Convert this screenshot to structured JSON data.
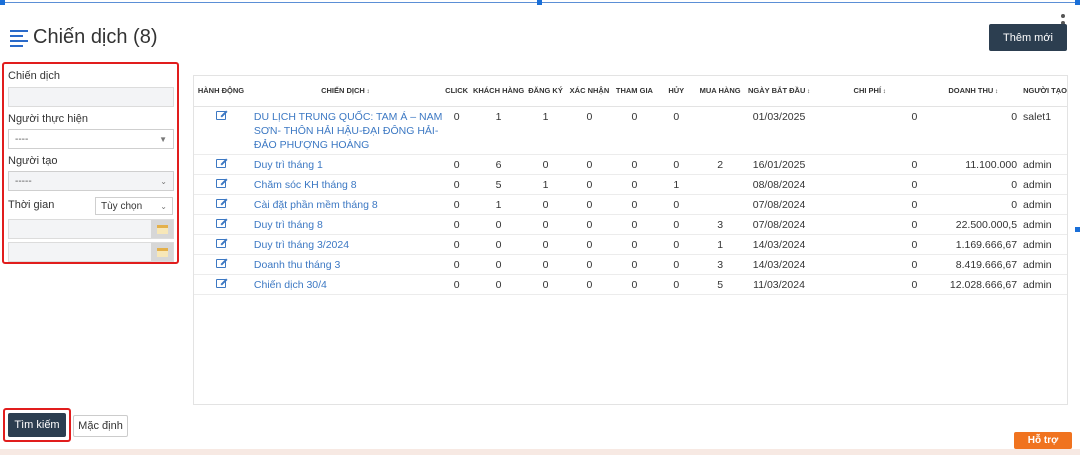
{
  "header": {
    "title": "Chiến dịch (8)",
    "add_label": "Thêm mới"
  },
  "filters": {
    "campaign_label": "Chiến dịch",
    "campaign_value": "",
    "performer_label": "Người thực hiện",
    "performer_value": "----",
    "creator_label": "Người tạo",
    "creator_value": "-----",
    "time_label": "Thời gian",
    "time_value": "Tùy chọn",
    "date_from": "",
    "date_to": ""
  },
  "actions": {
    "search_label": "Tìm kiếm",
    "default_label": "Mặc định",
    "support_label": "Hỗ trợ"
  },
  "table": {
    "headers": [
      "HÀNH ĐỘNG",
      "CHIẾN DỊCH",
      "CLICK",
      "KHÁCH HÀNG",
      "ĐĂNG KÝ",
      "XÁC NHẬN",
      "THAM GIA",
      "HỦY",
      "MUA HÀNG",
      "NGÀY BẮT ĐẦU",
      "CHI PHÍ",
      "DOANH THU",
      "NGƯỜI TẠO"
    ],
    "rows": [
      {
        "name": "DU LỊCH TRUNG QUỐC: TAM Á – NAM SƠN- THÔN HẢI HẬU-ĐẠI ĐÔNG HẢI- ĐẢO PHƯỢNG HOÀNG",
        "click": "0",
        "customers": "1",
        "register": "1",
        "confirm": "0",
        "join": "0",
        "cancel": "0",
        "buy": "",
        "start": "01/03/2025",
        "cost": "0",
        "revenue": "0",
        "creator": "salet1"
      },
      {
        "name": "Duy trì tháng 1",
        "click": "0",
        "customers": "6",
        "register": "0",
        "confirm": "0",
        "join": "0",
        "cancel": "0",
        "buy": "2",
        "start": "16/01/2025",
        "cost": "0",
        "revenue": "11.100.000",
        "creator": "admin"
      },
      {
        "name": "Chăm sóc KH tháng 8",
        "click": "0",
        "customers": "5",
        "register": "1",
        "confirm": "0",
        "join": "0",
        "cancel": "1",
        "buy": "",
        "start": "08/08/2024",
        "cost": "0",
        "revenue": "0",
        "creator": "admin"
      },
      {
        "name": "Cài đặt phần mềm tháng 8",
        "click": "0",
        "customers": "1",
        "register": "0",
        "confirm": "0",
        "join": "0",
        "cancel": "0",
        "buy": "",
        "start": "07/08/2024",
        "cost": "0",
        "revenue": "0",
        "creator": "admin"
      },
      {
        "name": "Duy trì tháng 8",
        "click": "0",
        "customers": "0",
        "register": "0",
        "confirm": "0",
        "join": "0",
        "cancel": "0",
        "buy": "3",
        "start": "07/08/2024",
        "cost": "0",
        "revenue": "22.500.000,5",
        "creator": "admin"
      },
      {
        "name": "Duy trì tháng 3/2024",
        "click": "0",
        "customers": "0",
        "register": "0",
        "confirm": "0",
        "join": "0",
        "cancel": "0",
        "buy": "1",
        "start": "14/03/2024",
        "cost": "0",
        "revenue": "1.169.666,67",
        "creator": "admin"
      },
      {
        "name": "Doanh thu tháng 3",
        "click": "0",
        "customers": "0",
        "register": "0",
        "confirm": "0",
        "join": "0",
        "cancel": "0",
        "buy": "3",
        "start": "14/03/2024",
        "cost": "0",
        "revenue": "8.419.666,67",
        "creator": "admin"
      },
      {
        "name": "Chiến dịch 30/4",
        "click": "0",
        "customers": "0",
        "register": "0",
        "confirm": "0",
        "join": "0",
        "cancel": "0",
        "buy": "5",
        "start": "11/03/2024",
        "cost": "0",
        "revenue": "12.028.666,67",
        "creator": "admin"
      }
    ]
  },
  "colors": {
    "link": "#3c78c3",
    "primary_button": "#2c3e50",
    "support": "#f0731f",
    "highlight_border": "#e11d1d"
  }
}
